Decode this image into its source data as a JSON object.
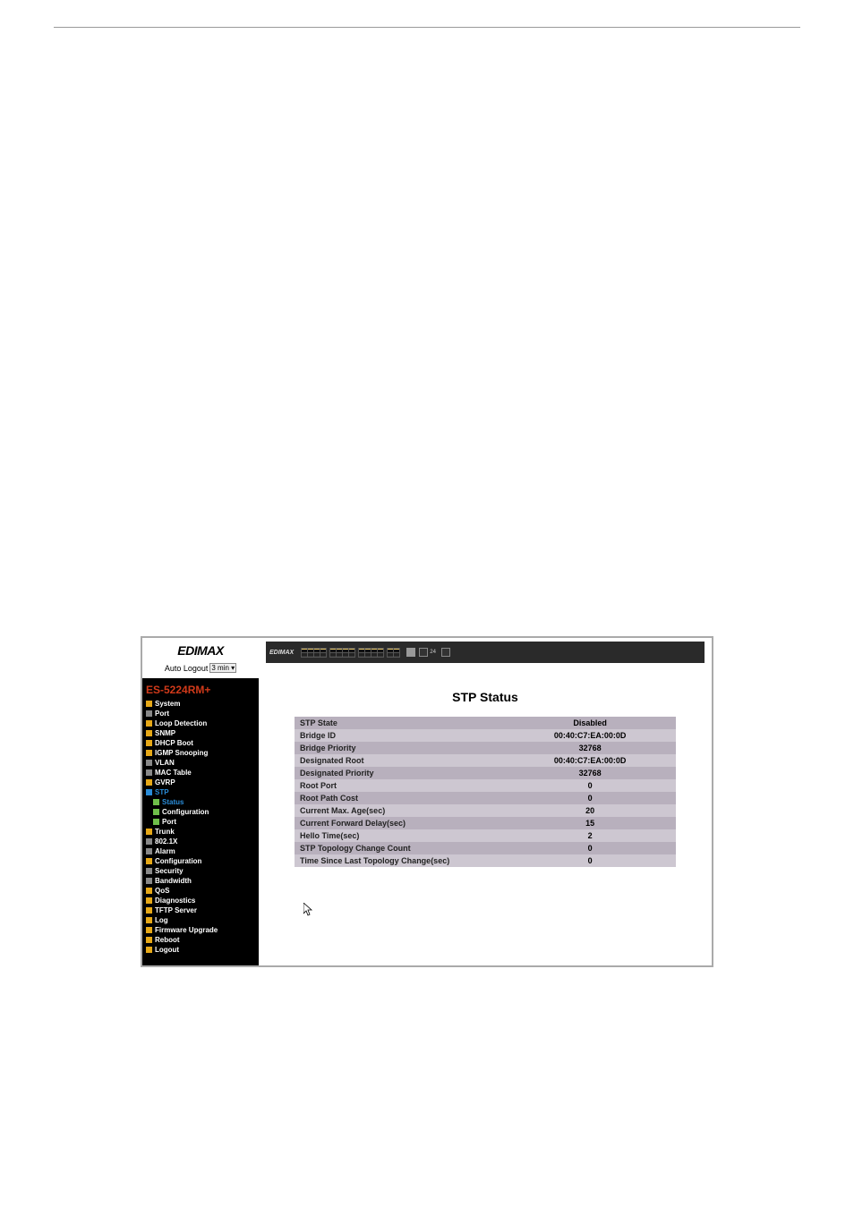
{
  "brand": "EDIMAX",
  "auto_logout_label": "Auto Logout",
  "auto_logout_value": "3 min",
  "nav_title": "ES-5224RM+",
  "nav": {
    "system": "System",
    "port": "Port",
    "loop_detection": "Loop Detection",
    "snmp": "SNMP",
    "dhcp_boot": "DHCP Boot",
    "igmp_snooping": "IGMP Snooping",
    "vlan": "VLAN",
    "mac_table": "MAC Table",
    "gvrp": "GVRP",
    "stp": "STP",
    "stp_status": "Status",
    "stp_configuration": "Configuration",
    "stp_port": "Port",
    "trunk": "Trunk",
    "x8021": "802.1X",
    "alarm": "Alarm",
    "configuration": "Configuration",
    "security": "Security",
    "bandwidth": "Bandwidth",
    "qos": "QoS",
    "diagnostics": "Diagnostics",
    "tftp_server": "TFTP Server",
    "log": "Log",
    "firmware_upgrade": "Firmware Upgrade",
    "reboot": "Reboot",
    "logout": "Logout"
  },
  "banner_label": "24",
  "page_title": "STP Status",
  "status_rows": [
    {
      "label": "STP State",
      "value": "Disabled"
    },
    {
      "label": "Bridge ID",
      "value": "00:40:C7:EA:00:0D"
    },
    {
      "label": "Bridge Priority",
      "value": "32768"
    },
    {
      "label": "Designated Root",
      "value": "00:40:C7:EA:00:0D"
    },
    {
      "label": "Designated Priority",
      "value": "32768"
    },
    {
      "label": "Root Port",
      "value": "0"
    },
    {
      "label": "Root Path Cost",
      "value": "0"
    },
    {
      "label": "Current Max. Age(sec)",
      "value": "20"
    },
    {
      "label": "Current Forward Delay(sec)",
      "value": "15"
    },
    {
      "label": "Hello Time(sec)",
      "value": "2"
    },
    {
      "label": "STP Topology Change Count",
      "value": "0"
    },
    {
      "label": "Time Since Last Topology Change(sec)",
      "value": "0"
    }
  ]
}
